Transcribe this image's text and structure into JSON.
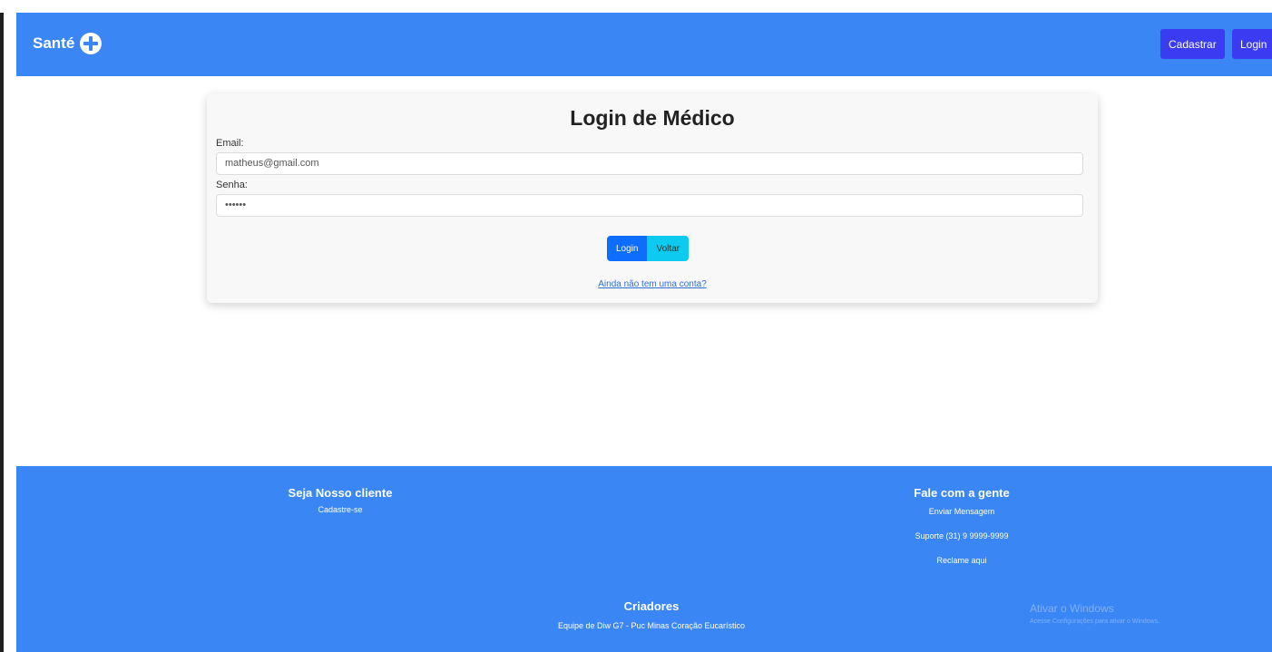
{
  "navbar": {
    "brand": "Santé",
    "brand_icon": "plus-circle-icon",
    "buttons": {
      "register": "Cadastrar",
      "login": "Login"
    },
    "color": "#3a86f5",
    "button_color": "#3b3bf2"
  },
  "login_card": {
    "title": "Login de Médico",
    "email_label": "Email:",
    "email_value": "matheus@gmail.com",
    "password_label": "Senha:",
    "password_value": "••••••",
    "login_button": "Login",
    "back_button": "Voltar",
    "signup_link": "Ainda não tem uma conta?"
  },
  "footer": {
    "client": {
      "heading": "Seja Nosso cliente",
      "link": "Cadastre-se"
    },
    "contact": {
      "heading": "Fale com a gente",
      "links": [
        "Enviar Mensagem",
        "Suporte (31) 9 9999-9999",
        "Reclame aqui"
      ]
    },
    "creators": {
      "heading": "Criadores",
      "text": "Equipe de Diw G7 - Puc Minas Coração Eucarístico"
    },
    "watermark": {
      "title": "Ativar o Windows",
      "subtitle": "Acesse Configurações para ativar o Windows."
    }
  }
}
